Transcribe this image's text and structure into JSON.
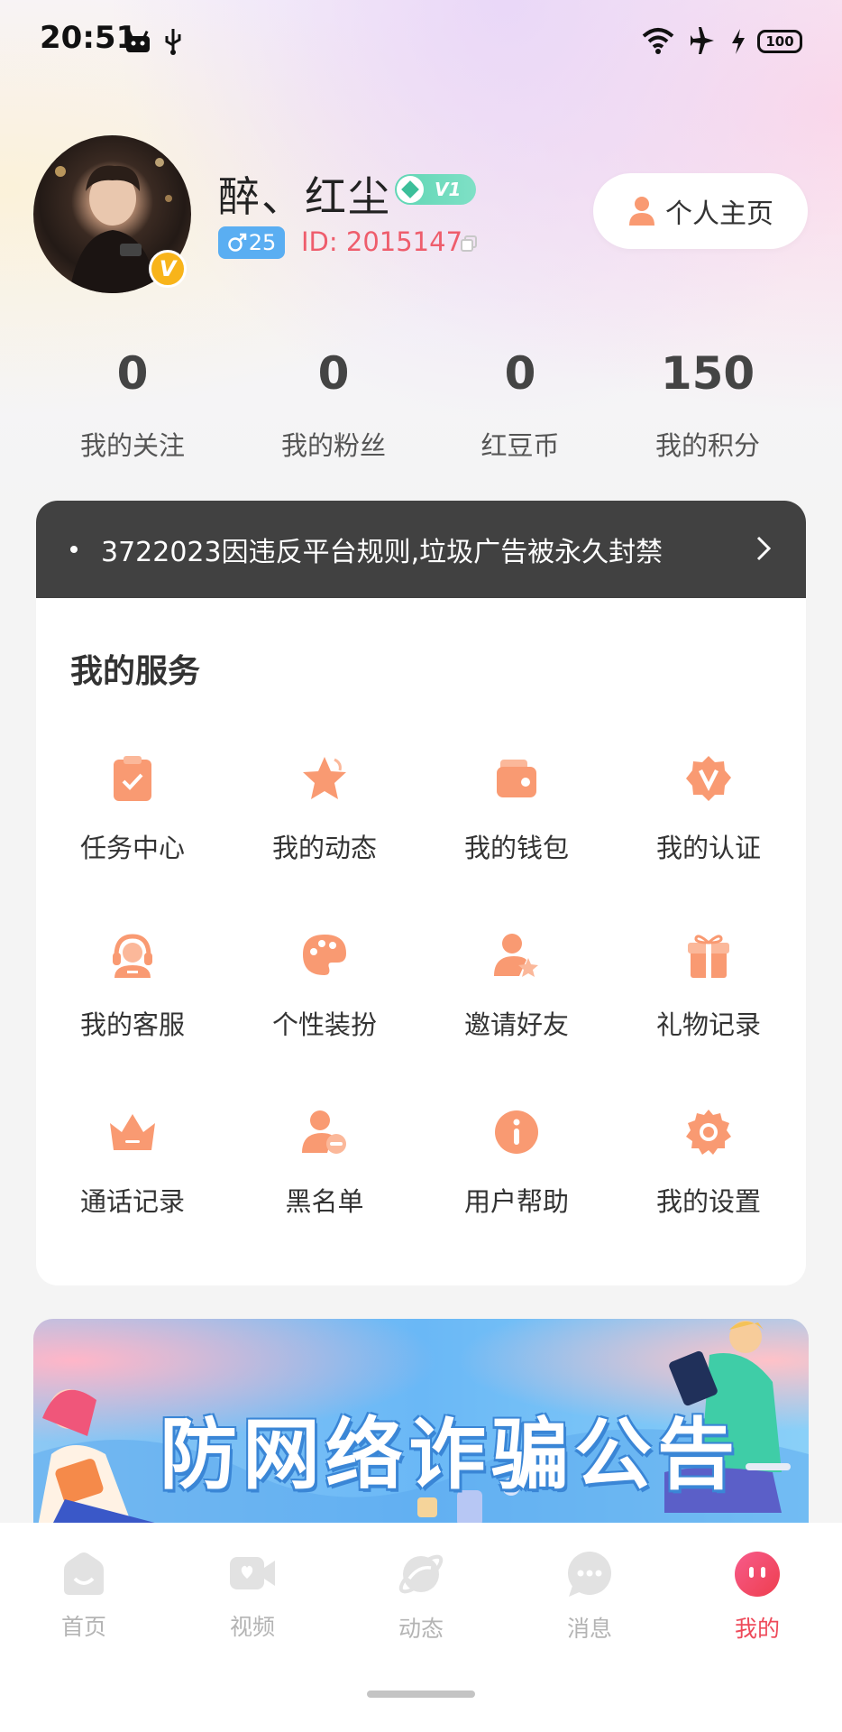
{
  "status_bar": {
    "time": "20:51",
    "battery": "100"
  },
  "profile": {
    "username": "醉、红尘",
    "vip_level": "V1",
    "gender_age": "25",
    "id_text": "ID: 2015147",
    "verified_mark": "V",
    "homepage_label": "个人主页"
  },
  "stats": [
    {
      "value": "0",
      "label": "我的关注"
    },
    {
      "value": "0",
      "label": "我的粉丝"
    },
    {
      "value": "0",
      "label": "红豆币"
    },
    {
      "value": "150",
      "label": "我的积分"
    }
  ],
  "notice": {
    "text": "3722023因违反平台规则,垃圾广告被永久封禁"
  },
  "services": {
    "title": "我的服务",
    "items": [
      {
        "label": "任务中心",
        "icon": "clipboard-check-icon"
      },
      {
        "label": "我的动态",
        "icon": "star-icon"
      },
      {
        "label": "我的钱包",
        "icon": "wallet-icon"
      },
      {
        "label": "我的认证",
        "icon": "verified-badge-icon"
      },
      {
        "label": "我的客服",
        "icon": "headset-icon"
      },
      {
        "label": "个性装扮",
        "icon": "palette-icon"
      },
      {
        "label": "邀请好友",
        "icon": "user-star-icon"
      },
      {
        "label": "礼物记录",
        "icon": "gift-icon"
      },
      {
        "label": "通话记录",
        "icon": "crown-icon"
      },
      {
        "label": "黑名单",
        "icon": "user-minus-icon"
      },
      {
        "label": "用户帮助",
        "icon": "info-icon"
      },
      {
        "label": "我的设置",
        "icon": "gear-icon"
      }
    ]
  },
  "banner": {
    "text": "防网络诈骗公告"
  },
  "bottom_nav": [
    {
      "label": "首页",
      "icon": "home-icon"
    },
    {
      "label": "视频",
      "icon": "video-icon"
    },
    {
      "label": "动态",
      "icon": "planet-icon"
    },
    {
      "label": "消息",
      "icon": "chat-icon"
    },
    {
      "label": "我的",
      "icon": "profile-icon",
      "active": true
    }
  ],
  "colors": {
    "accent": "#f98a6a",
    "active_tab": "#ee4a5a",
    "id_color": "#ee5d6c"
  }
}
